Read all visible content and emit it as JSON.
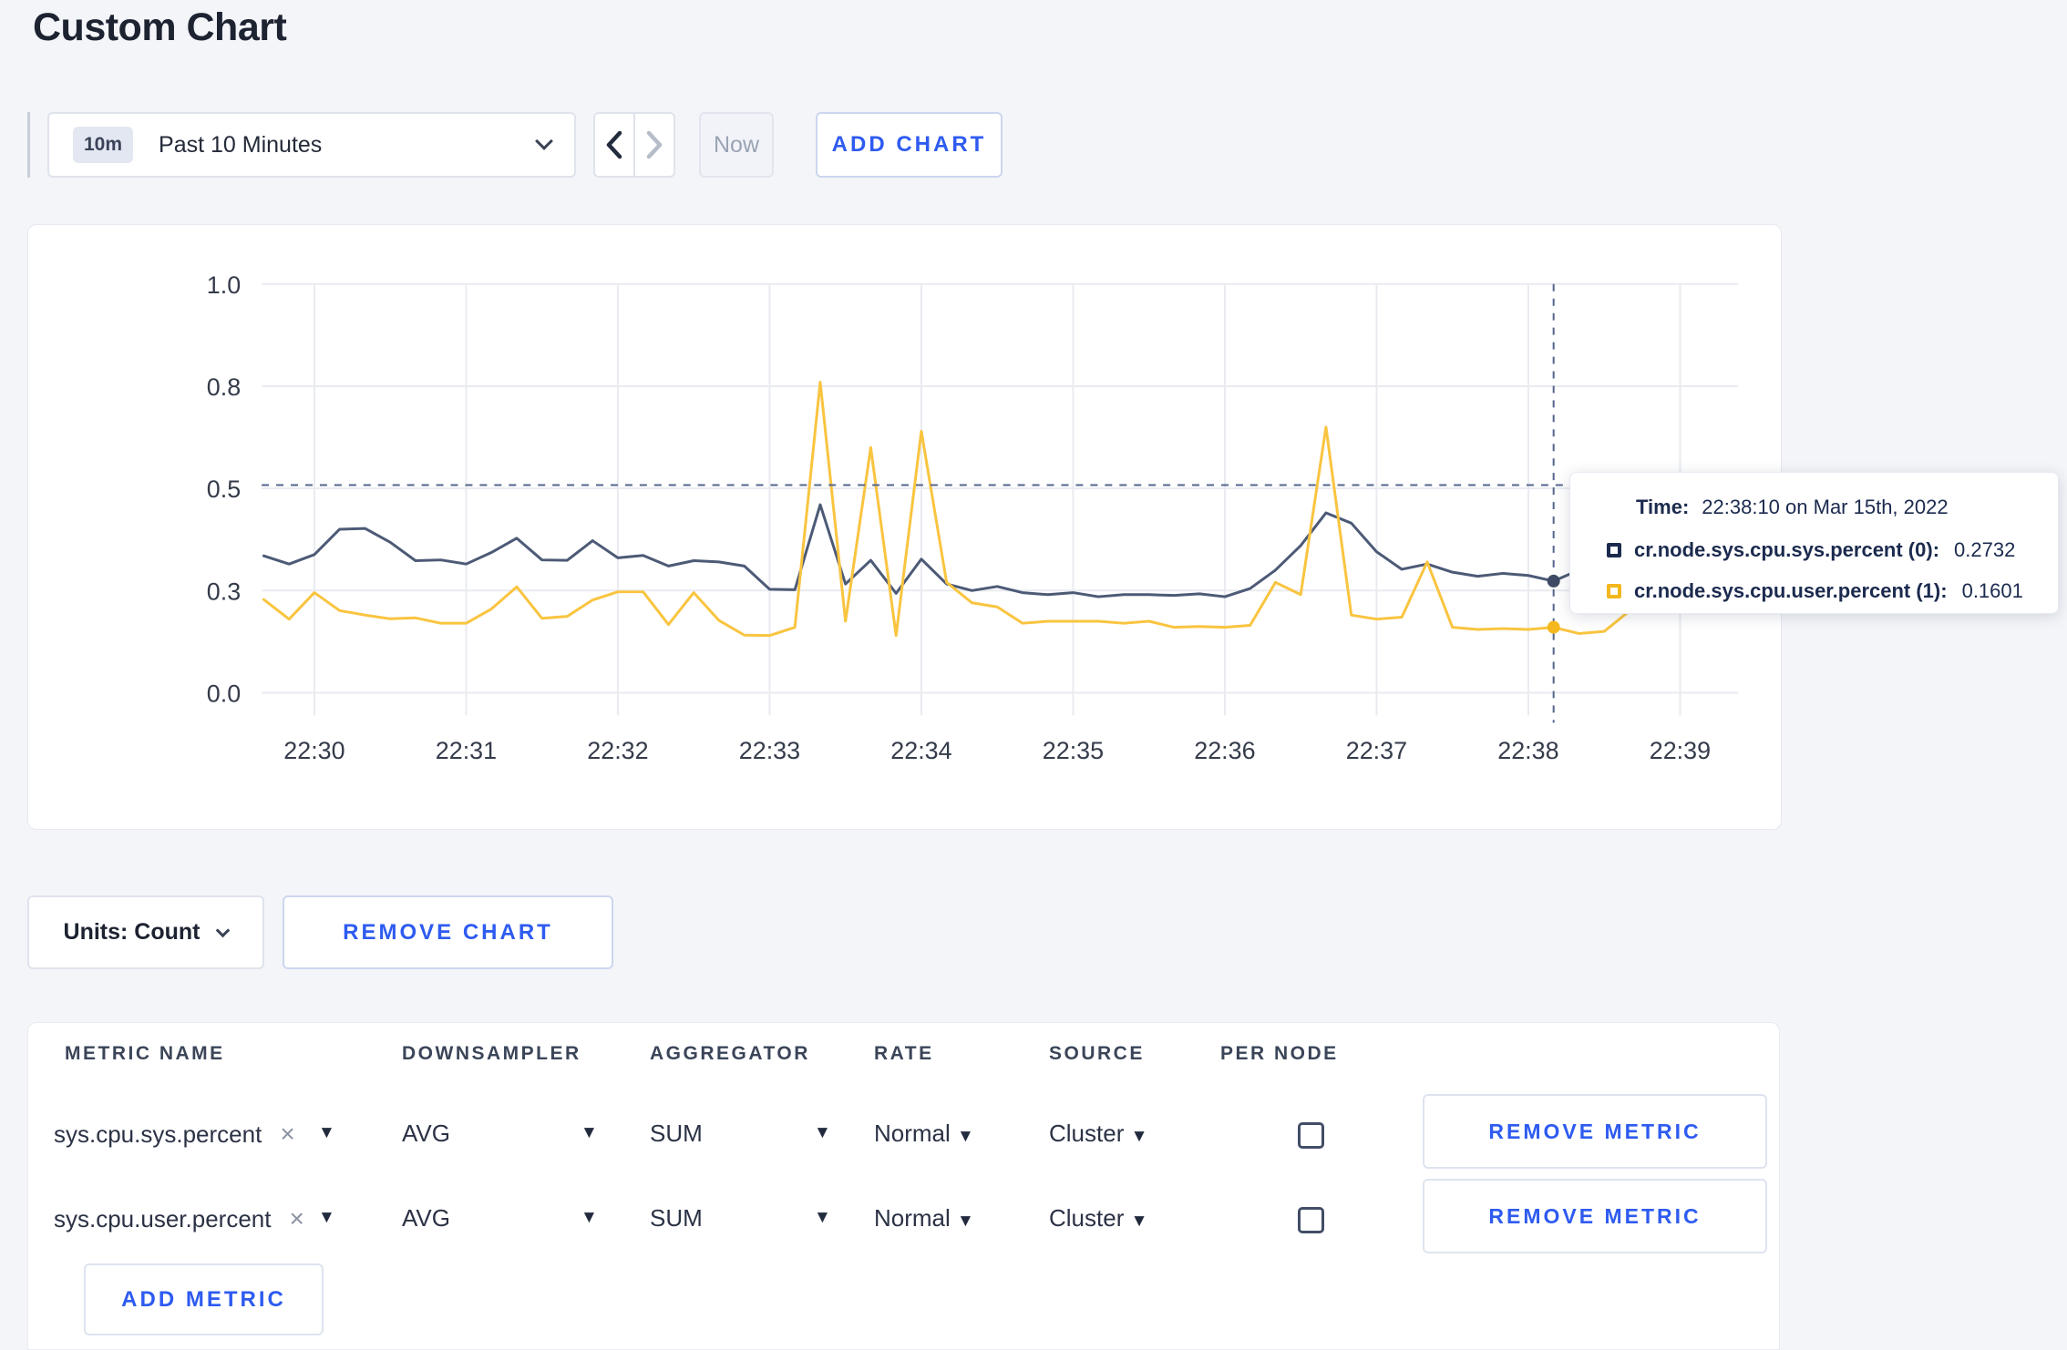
{
  "page": {
    "title": "Custom Chart",
    "background": "#f4f5f9",
    "accent_blue": "#2e5bf0"
  },
  "toolbar": {
    "time_badge": "10m",
    "time_label": "Past 10 Minutes",
    "now_label": "Now",
    "add_chart_label": "ADD CHART"
  },
  "chart_data": {
    "type": "line",
    "title": "",
    "xlabel": "",
    "ylabel": "",
    "x_ticks": [
      "22:30",
      "22:31",
      "22:32",
      "22:33",
      "22:34",
      "22:35",
      "22:36",
      "22:37",
      "22:38",
      "22:39"
    ],
    "x_start_min": -0.333333,
    "x_step_min": 0.166667,
    "y_axis": {
      "min": 0,
      "max": 1,
      "gridlines": [
        {
          "value": 0,
          "label": "0.0"
        },
        {
          "value": 0.25,
          "label": "0.3"
        },
        {
          "value": 0.5,
          "label": "0.5"
        },
        {
          "value": 0.75,
          "label": "0.8"
        },
        {
          "value": 1,
          "label": "1.0"
        }
      ]
    },
    "style": {
      "grid_color": "#e9ebf0",
      "dash_color": "#54658c"
    },
    "series": [
      {
        "id": "sys",
        "name": "cr.node.sys.cpu.sys.percent",
        "color": "#4c5a76",
        "values": [
          0.335,
          0.315,
          0.338,
          0.4,
          0.402,
          0.368,
          0.323,
          0.325,
          0.315,
          0.343,
          0.378,
          0.325,
          0.324,
          0.372,
          0.33,
          0.336,
          0.31,
          0.323,
          0.32,
          0.31,
          0.253,
          0.252,
          0.46,
          0.266,
          0.324,
          0.243,
          0.327,
          0.266,
          0.25,
          0.26,
          0.245,
          0.24,
          0.245,
          0.235,
          0.24,
          0.24,
          0.238,
          0.242,
          0.235,
          0.255,
          0.3,
          0.36,
          0.44,
          0.415,
          0.345,
          0.302,
          0.315,
          0.295,
          0.285,
          0.292,
          0.287,
          0.2732,
          0.3,
          0.295,
          0.298,
          0.302,
          0.308,
          0.295
        ]
      },
      {
        "id": "user",
        "name": "cr.node.sys.cpu.user.percent",
        "color": "#f9c43f",
        "values": [
          0.228,
          0.18,
          0.245,
          0.201,
          0.19,
          0.181,
          0.183,
          0.17,
          0.17,
          0.205,
          0.259,
          0.182,
          0.187,
          0.227,
          0.247,
          0.247,
          0.167,
          0.245,
          0.177,
          0.141,
          0.14,
          0.16,
          0.76,
          0.175,
          0.6,
          0.14,
          0.64,
          0.27,
          0.22,
          0.21,
          0.17,
          0.175,
          0.175,
          0.175,
          0.17,
          0.175,
          0.16,
          0.162,
          0.16,
          0.165,
          0.27,
          0.24,
          0.65,
          0.19,
          0.18,
          0.185,
          0.32,
          0.16,
          0.155,
          0.157,
          0.155,
          0.1601,
          0.145,
          0.15,
          0.2,
          0.265,
          0.28,
          0.235
        ]
      }
    ],
    "crosshair": {
      "time": "22:38:10",
      "x_min": 8.166667,
      "hover_value": 0.508,
      "dots": [
        {
          "series": "sys",
          "value": 0.2732,
          "color": "#3e4a66"
        },
        {
          "series": "user",
          "value": 0.1601,
          "color": "#f5b91f"
        }
      ]
    },
    "legend_position": "tooltip"
  },
  "tooltip": {
    "time_prefix": "Time:",
    "time_value": "22:38:10 on Mar 15th, 2022",
    "rows": [
      {
        "label": "cr.node.sys.cpu.sys.percent (0):",
        "value": "0.2732",
        "color": "#1c2b4e"
      },
      {
        "label": "cr.node.sys.cpu.user.percent (1):",
        "value": "0.1601",
        "color": "#f3b71d"
      }
    ]
  },
  "units_row": {
    "units_label": "Units: Count",
    "remove_chart_label": "REMOVE CHART"
  },
  "metrics_table": {
    "headers": [
      "METRIC NAME",
      "DOWNSAMPLER",
      "AGGREGATOR",
      "RATE",
      "SOURCE",
      "PER NODE"
    ],
    "rows": [
      {
        "metric": "sys.cpu.sys.percent",
        "remove_tag": "×",
        "downsampler": "AVG",
        "aggregator": "SUM",
        "rate": "Normal",
        "source": "Cluster",
        "per_node_checked": false,
        "remove_label": "REMOVE METRIC"
      },
      {
        "metric": "sys.cpu.user.percent",
        "remove_tag": "×",
        "downsampler": "AVG",
        "aggregator": "SUM",
        "rate": "Normal",
        "source": "Cluster",
        "per_node_checked": false,
        "remove_label": "REMOVE METRIC"
      }
    ],
    "dropdown_glyph": "▼",
    "add_metric_label": "ADD METRIC"
  }
}
